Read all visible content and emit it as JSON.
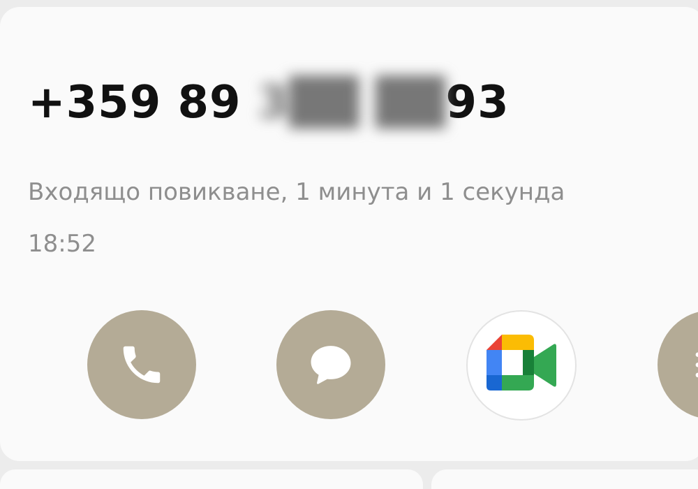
{
  "contact": {
    "number_prefix": "+359 89 ",
    "number_hidden": "3██ ██",
    "number_suffix": "93"
  },
  "call": {
    "description": "Входящо повикване, 1 минута и 1 секунда",
    "time": "18:52"
  },
  "actions": [
    {
      "name": "call",
      "icon": "phone-icon"
    },
    {
      "name": "message",
      "icon": "message-bubble-icon"
    },
    {
      "name": "video-call",
      "icon": "google-meet-icon"
    },
    {
      "name": "more",
      "icon": "list-icon"
    }
  ],
  "colors": {
    "action_button": "#b4ab96",
    "card_background": "#fafafa",
    "page_background": "#ececec",
    "secondary_text": "#8e8e8e"
  }
}
